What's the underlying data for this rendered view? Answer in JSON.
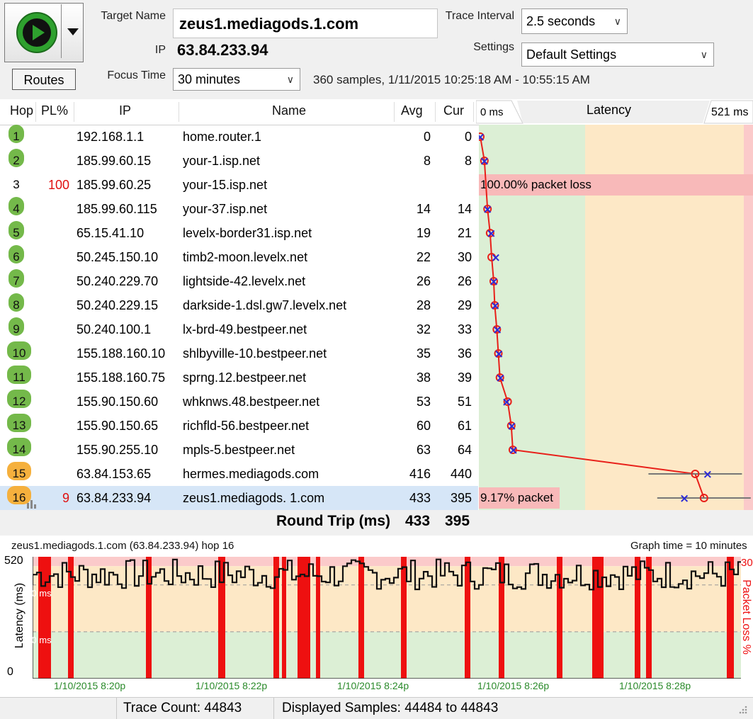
{
  "toolbar": {
    "target_name_label": "Target Name",
    "target_name_value": "zeus1.mediagods.1.com",
    "ip_label": "IP",
    "ip_value": "63.84.233.94",
    "focus_time_label": "Focus Time",
    "focus_time_value": "30 minutes",
    "trace_interval_label": "Trace Interval",
    "trace_interval_value": "2.5 seconds",
    "settings_label": "Settings",
    "settings_value": "Default Settings",
    "samples_info": "360 samples, 1/11/2015 10:25:18 AM - 10:55:15 AM",
    "routes_label": "Routes"
  },
  "table": {
    "headers": {
      "hop": "Hop",
      "pl": "PL%",
      "ip": "IP",
      "name": "Name",
      "avg": "Avg",
      "cur": "Cur"
    },
    "latency_header": {
      "min": "0 ms",
      "title": "Latency",
      "max": "521 ms"
    },
    "rows": [
      {
        "hop": "1",
        "pl": "",
        "ip": "192.168.1.1",
        "name": "home.router.1",
        "avg": "0",
        "cur": "0",
        "badge": "green",
        "avg_ms": 0,
        "cur_ms": 0
      },
      {
        "hop": "2",
        "pl": "",
        "ip": "185.99.60.15",
        "name": "your-1.isp.net",
        "avg": "8",
        "cur": "8",
        "badge": "green",
        "avg_ms": 8,
        "cur_ms": 8
      },
      {
        "hop": "3",
        "pl": "100",
        "ip": "185.99.60.25",
        "name": "your-15.isp.net",
        "avg": "",
        "cur": "",
        "badge": "plain",
        "loss_text": "100.00% packet loss"
      },
      {
        "hop": "4",
        "pl": "",
        "ip": "185.99.60.115",
        "name": "your-37.isp.net",
        "avg": "14",
        "cur": "14",
        "badge": "green",
        "avg_ms": 14,
        "cur_ms": 14
      },
      {
        "hop": "5",
        "pl": "",
        "ip": "65.15.41.10",
        "name": "levelx-border31.isp.net",
        "avg": "19",
        "cur": "21",
        "badge": "green",
        "avg_ms": 19,
        "cur_ms": 21
      },
      {
        "hop": "6",
        "pl": "",
        "ip": "50.245.150.10",
        "name": "timb2-moon.levelx.net",
        "avg": "22",
        "cur": "30",
        "badge": "green",
        "avg_ms": 22,
        "cur_ms": 30
      },
      {
        "hop": "7",
        "pl": "",
        "ip": "50.240.229.70",
        "name": "lightside-42.levelx.net",
        "avg": "26",
        "cur": "26",
        "badge": "green",
        "avg_ms": 26,
        "cur_ms": 26
      },
      {
        "hop": "8",
        "pl": "",
        "ip": "50.240.229.15",
        "name": "darkside-1.dsl.gw7.levelx.net",
        "avg": "28",
        "cur": "29",
        "badge": "green",
        "avg_ms": 28,
        "cur_ms": 29
      },
      {
        "hop": "9",
        "pl": "",
        "ip": "50.240.100.1",
        "name": "lx-brd-49.bestpeer.net",
        "avg": "32",
        "cur": "33",
        "badge": "green",
        "avg_ms": 32,
        "cur_ms": 33
      },
      {
        "hop": "10",
        "pl": "",
        "ip": "155.188.160.10",
        "name": "shlbyville-10.bestpeer.net",
        "avg": "35",
        "cur": "36",
        "badge": "green",
        "avg_ms": 35,
        "cur_ms": 36
      },
      {
        "hop": "11",
        "pl": "",
        "ip": "155.188.160.75",
        "name": "sprng.12.bestpeer.net",
        "avg": "38",
        "cur": "39",
        "badge": "green",
        "avg_ms": 38,
        "cur_ms": 39
      },
      {
        "hop": "12",
        "pl": "",
        "ip": "155.90.150.60",
        "name": "whknws.48.bestpeer.net",
        "avg": "53",
        "cur": "51",
        "badge": "green",
        "avg_ms": 53,
        "cur_ms": 51
      },
      {
        "hop": "13",
        "pl": "",
        "ip": "155.90.150.65",
        "name": "richfld-56.bestpeer.net",
        "avg": "60",
        "cur": "61",
        "badge": "green",
        "avg_ms": 60,
        "cur_ms": 61
      },
      {
        "hop": "14",
        "pl": "",
        "ip": "155.90.255.10",
        "name": "mpls-5.bestpeer.net",
        "avg": "63",
        "cur": "64",
        "badge": "green",
        "avg_ms": 63,
        "cur_ms": 64
      },
      {
        "hop": "15",
        "pl": "",
        "ip": "63.84.153.65",
        "name": "hermes.mediagods.com",
        "avg": "416",
        "cur": "440",
        "badge": "orange",
        "avg_ms": 416,
        "cur_ms": 440
      },
      {
        "hop": "16",
        "pl": "9",
        "ip": "63.84.233.94",
        "name": "zeus1.mediagods. 1.com",
        "avg": "433",
        "cur": "395",
        "badge": "orange",
        "avg_ms": 433,
        "cur_ms": 395,
        "loss_text": "9.17% packet",
        "selected": true
      }
    ]
  },
  "round_trip": {
    "label": "Round Trip (ms)",
    "avg": "433",
    "cur": "395"
  },
  "history_graph": {
    "title": "zeus1.mediagods.1.com (63.84.233.94) hop 16",
    "graph_time": "Graph time = 10 minutes",
    "y_axis_label": "Latency (ms)",
    "y_top_tick": "520",
    "y_bottom_tick": "0",
    "gridline_400": "400 ms",
    "gridline_200": "200 ms",
    "right_axis_label": "Packet Loss %",
    "right_top_tick": "30",
    "x_ticks": [
      "1/10/2015 8:20p",
      "1/10/2015 8:22p",
      "1/10/2015 8:24p",
      "1/10/2015 8:26p",
      "1/10/2015 8:28p"
    ]
  },
  "status": {
    "trace_count": "Trace Count: 44843",
    "displayed_samples": "Displayed Samples: 44484 to 44843"
  },
  "colors": {
    "green_zone": "#dcefd5",
    "orange_zone": "#fde8c6",
    "red_zone": "#fbcaca",
    "loss_bar": "#f8b9b9",
    "badge_green": "#74b94a",
    "badge_orange": "#f5b03d",
    "trace_line": "#e8201a",
    "marker_x": "#2b2bd8",
    "loss_spike": "#ee1010",
    "play_green": "#2ea12e"
  }
}
